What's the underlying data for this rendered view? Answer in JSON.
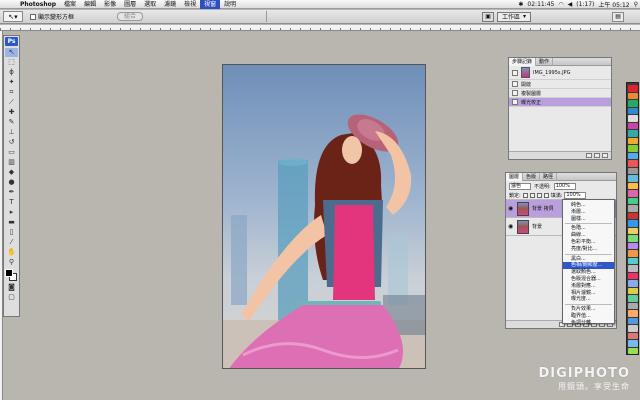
{
  "menubar": {
    "app_name": "Photoshop",
    "items": [
      "檔案",
      "編輯",
      "影像",
      "圖層",
      "選取",
      "濾鏡",
      "檢視",
      "視窗",
      "說明"
    ],
    "active_index": 7,
    "time": "02:11:45",
    "battery": "(1:17)",
    "clock": "上午 05:12"
  },
  "options_bar": {
    "check_label": "顯示變形方框",
    "button_label": "組合",
    "workspace_label": "工作區"
  },
  "history_panel": {
    "tabs": [
      "步驟記錄",
      "動作"
    ],
    "snapshot_name": "IMG_1995s.JPG",
    "steps": [
      "開啟",
      "複製圖層",
      "曝光校正"
    ],
    "selected_index": 2
  },
  "layers_panel": {
    "tabs": [
      "圖層",
      "色版",
      "路徑"
    ],
    "blend_mode": "濾色",
    "opacity_label": "不透明:",
    "opacity_value": "100%",
    "lock_label": "鎖定:",
    "fill_label": "填滿:",
    "fill_value": "100%",
    "layers": [
      {
        "name": "背景 拷貝",
        "selected": true
      },
      {
        "name": "背景",
        "selected": false
      }
    ]
  },
  "context_menu": {
    "items": [
      "純色...",
      "漸層...",
      "圖樣...",
      "-",
      "色階...",
      "曲線...",
      "色彩平衡...",
      "亮度/對比...",
      "-",
      "黑白...",
      "色相/飽和度...",
      "選取顏色...",
      "色版混合器...",
      "漸層對應...",
      "相片濾鏡...",
      "曝光度...",
      "-",
      "負片效果...",
      "臨界值...",
      "色調分離..."
    ],
    "highlighted_index": 10
  },
  "watermark": {
    "title": "DIGIPHOTO",
    "subtitle": "用鏡頭。享受生命"
  }
}
